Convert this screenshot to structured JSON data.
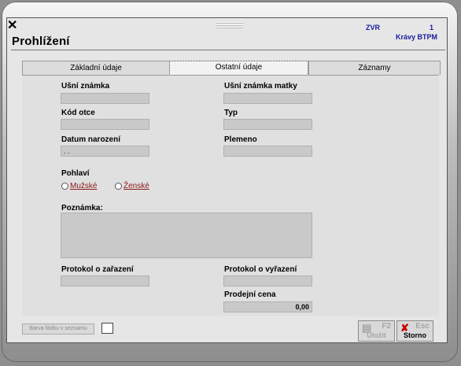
{
  "window": {
    "title": "Prohlížení",
    "header_right": {
      "code": "ZVR",
      "number": "1",
      "subtitle": "Krávy BTPM"
    }
  },
  "tabs": [
    {
      "label": "Základní údaje",
      "active": false
    },
    {
      "label": "Ostatní údaje",
      "active": true
    },
    {
      "label": "Záznamy",
      "active": false
    }
  ],
  "form": {
    "ear_tag_label": "Ušní známka",
    "ear_tag_value": "",
    "mother_ear_tag_label": "Ušní známka matky",
    "mother_ear_tag_value": "",
    "father_code_label": "Kód otce",
    "father_code_value": "",
    "type_label": "Typ",
    "type_value": "",
    "birth_date_label": "Datum narození",
    "birth_date_value": ". .",
    "breed_label": "Plemeno",
    "breed_value": "",
    "sex_label": "Pohlaví",
    "male_label": "Mužské",
    "female_label": "Ženské",
    "note_label": "Poznámka:",
    "note_value": "",
    "protocol_in_label": "Protokol o zařazení",
    "protocol_in_value": "",
    "protocol_out_label": "Protokol o vyřazení",
    "protocol_out_value": "",
    "sale_price_label": "Prodejní cena",
    "sale_price_value": "0,00"
  },
  "footer": {
    "row_color_button": "Barva řádku v seznamu",
    "save": {
      "key": "F2",
      "label": "Uložit",
      "enabled": false
    },
    "cancel": {
      "key": "Esc",
      "label": "Storno",
      "enabled": true
    }
  }
}
